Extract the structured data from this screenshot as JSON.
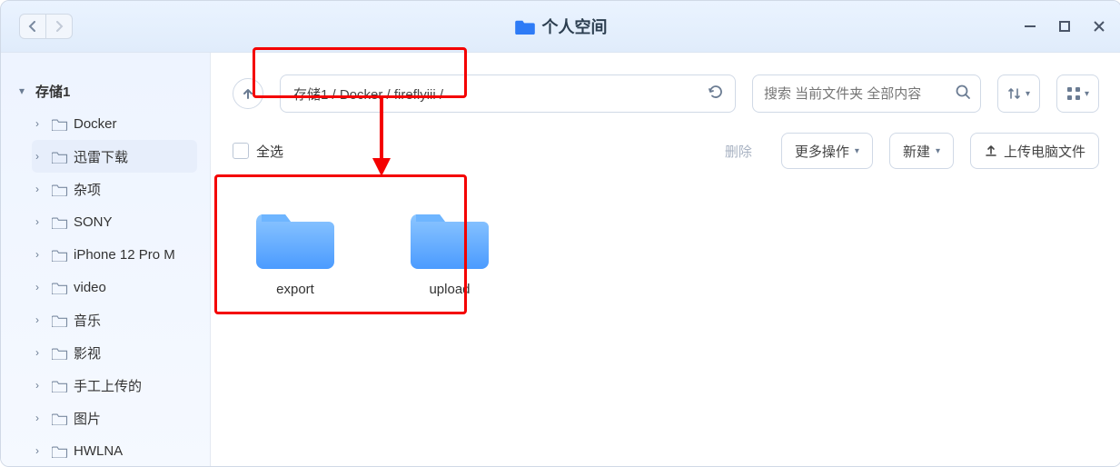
{
  "title": "个人空间",
  "sidebar": {
    "root_label": "存储1",
    "items": [
      {
        "label": "Docker",
        "selected": false
      },
      {
        "label": "迅雷下载",
        "selected": true
      },
      {
        "label": "杂项",
        "selected": false
      },
      {
        "label": "SONY",
        "selected": false
      },
      {
        "label": "iPhone 12 Pro M",
        "selected": false
      },
      {
        "label": "video",
        "selected": false
      },
      {
        "label": "音乐",
        "selected": false
      },
      {
        "label": "影视",
        "selected": false
      },
      {
        "label": "手工上传的",
        "selected": false
      },
      {
        "label": "图片",
        "selected": false
      },
      {
        "label": "HWLNA",
        "selected": false
      }
    ]
  },
  "breadcrumb": "存储1 / Docker / fireflyiii /",
  "search_placeholder": "搜索 当前文件夹 全部内容",
  "select_all_label": "全选",
  "actions": {
    "delete": "删除",
    "more": "更多操作",
    "new": "新建",
    "upload": "上传电脑文件"
  },
  "folders": [
    {
      "name": "export"
    },
    {
      "name": "upload"
    }
  ]
}
